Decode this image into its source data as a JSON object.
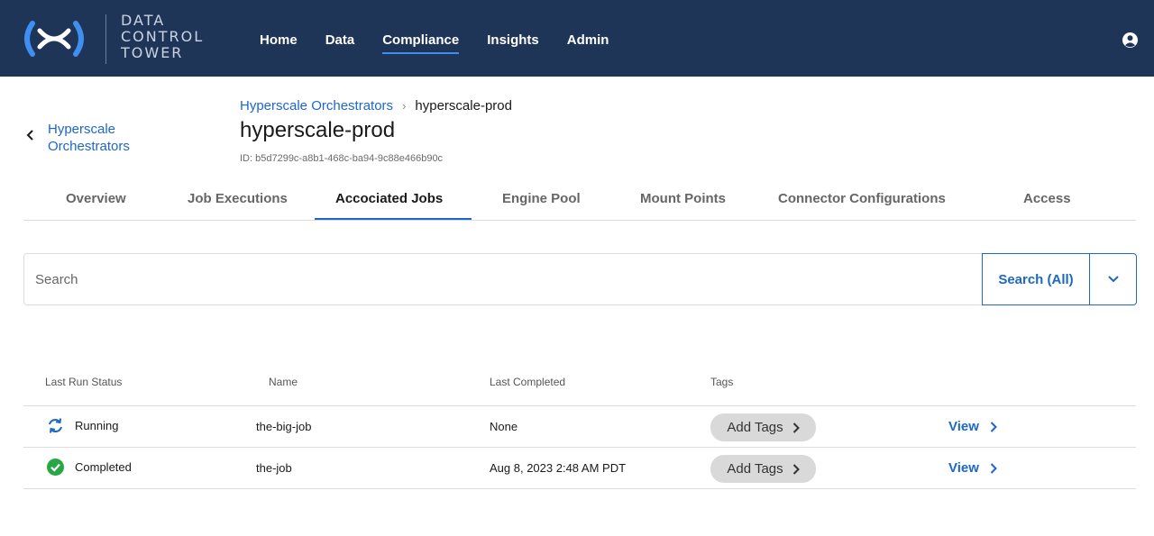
{
  "brand": {
    "line1": "DATA",
    "line2": "CONTROL",
    "line3": "TOWER"
  },
  "nav": {
    "items": [
      {
        "label": "Home"
      },
      {
        "label": "Data"
      },
      {
        "label": "Compliance"
      },
      {
        "label": "Insights"
      },
      {
        "label": "Admin"
      }
    ],
    "active": "Compliance"
  },
  "user_icon": "user-circle-icon",
  "back": {
    "label": "Hyperscale Orchestrators"
  },
  "breadcrumb": {
    "parent": "Hyperscale Orchestrators",
    "current": "hyperscale-prod"
  },
  "page": {
    "title": "hyperscale-prod",
    "id": "ID: b5d7299c-a8b1-468c-ba94-9c88e466b90c"
  },
  "tabs": [
    {
      "label": "Overview"
    },
    {
      "label": "Job Executions"
    },
    {
      "label": "Accociated Jobs"
    },
    {
      "label": "Engine Pool"
    },
    {
      "label": "Mount Points"
    },
    {
      "label": "Connector Configurations"
    },
    {
      "label": "Access"
    }
  ],
  "active_tab": "Accociated Jobs",
  "search": {
    "placeholder": "Search",
    "button_label": "Search (All)"
  },
  "table": {
    "headers": {
      "status": "Last Run Status",
      "name": "Name",
      "completed": "Last Completed",
      "tags": "Tags"
    },
    "rows": [
      {
        "status": "Running",
        "status_icon": "sync-icon",
        "name": "the-big-job",
        "completed": "None",
        "tag_label": "Add Tags",
        "view_label": "View"
      },
      {
        "status": "Completed",
        "status_icon": "check-circle-icon",
        "name": "the-job",
        "completed": "Aug 8, 2023 2:48 AM PDT",
        "tag_label": "Add Tags",
        "view_label": "View"
      }
    ]
  },
  "colors": {
    "topbar": "#1f3558",
    "accent": "#1d67c7",
    "success": "#28a745"
  }
}
